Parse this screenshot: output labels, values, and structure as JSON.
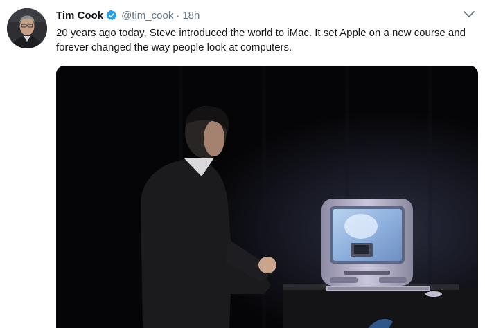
{
  "tweet": {
    "author_name": "Tim Cook",
    "handle": "@tim_cook",
    "separator": "·",
    "timestamp": "18h",
    "text": "20 years ago today, Steve introduced the world to iMac. It set Apple on a new course and forever changed the way people look at computers.",
    "verified": true
  },
  "icons": {
    "verified": "verified-badge-icon",
    "menu": "chevron-down-icon"
  },
  "colors": {
    "verified_blue": "#1da1f2",
    "name_text": "#14171a",
    "meta_text": "#657786"
  }
}
